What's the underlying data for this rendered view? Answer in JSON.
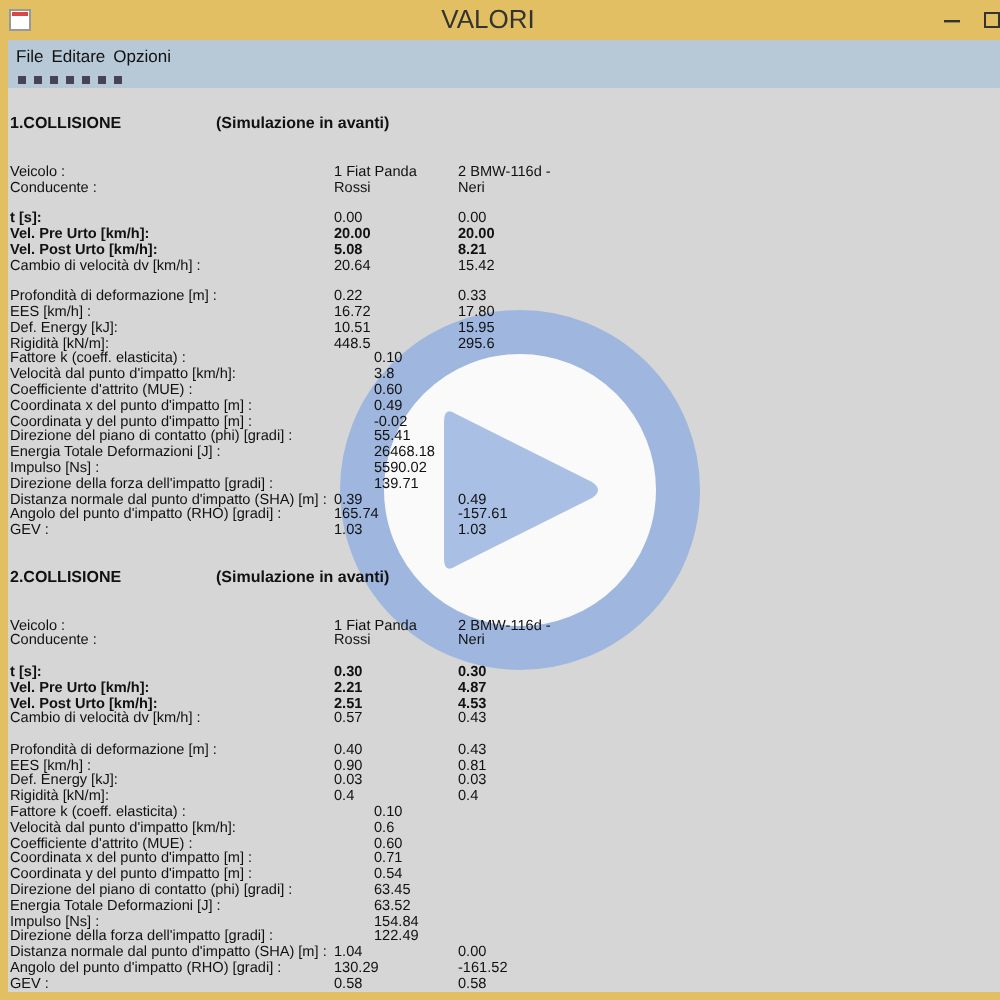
{
  "window": {
    "title": "VALORI"
  },
  "menu": [
    "File",
    "Editare",
    "Opzioni"
  ],
  "sections": [
    {
      "title": "1.COLLISIONE",
      "subtitle": "(Simulazione in avanti)",
      "rows": [
        {
          "kind": "gap"
        },
        {
          "kind": "pair",
          "label": "Veicolo :",
          "values": [
            "1  Fiat Panda",
            "2  BMW-116d -"
          ],
          "bold_label": false,
          "bold_values": false
        },
        {
          "kind": "pair",
          "label": "Conducente :",
          "values": [
            "Rossi",
            "Neri"
          ],
          "bold_label": false,
          "bold_values": false
        },
        {
          "kind": "gap"
        },
        {
          "kind": "pair",
          "label": "t [s]:",
          "values": [
            "0.00",
            "0.00"
          ],
          "bold_label": true,
          "bold_values": false
        },
        {
          "kind": "pair",
          "label": "Vel. Pre Urto [km/h]:",
          "values": [
            "20.00",
            "20.00"
          ],
          "bold_label": true,
          "bold_values": true
        },
        {
          "kind": "pair",
          "label": "Vel. Post Urto [km/h]:",
          "values": [
            "5.08",
            "8.21"
          ],
          "bold_label": true,
          "bold_values": true
        },
        {
          "kind": "pair",
          "label": "Cambio di velocità dv [km/h] :",
          "values": [
            "20.64",
            "15.42"
          ],
          "bold_label": false,
          "bold_values": false
        },
        {
          "kind": "gap"
        },
        {
          "kind": "pair",
          "label": "Profondità di deformazione [m] :",
          "values": [
            "0.22",
            "0.33"
          ],
          "bold_label": false,
          "bold_values": false
        },
        {
          "kind": "pair",
          "label": "EES [km/h] :",
          "values": [
            "16.72",
            "17.80"
          ],
          "bold_label": false,
          "bold_values": false
        },
        {
          "kind": "pair",
          "label": "Def. Energy [kJ]:",
          "values": [
            "10.51",
            "15.95"
          ],
          "bold_label": false,
          "bold_values": false
        },
        {
          "kind": "pair",
          "label": "Rigidità [kN/m]:",
          "values": [
            "448.5",
            "295.6"
          ],
          "bold_label": false,
          "bold_values": false
        },
        {
          "kind": "single",
          "label": "Fattore k (coeff. elasticita) :",
          "value": "0.10"
        },
        {
          "kind": "single",
          "label": "Velocità dal punto d'impatto [km/h]:",
          "value": "3.8"
        },
        {
          "kind": "single",
          "label": "Coefficiente d'attrito (MUE) :",
          "value": "0.60"
        },
        {
          "kind": "single",
          "label": "Coordinata x del punto d'impatto [m] :",
          "value": "0.49"
        },
        {
          "kind": "single",
          "label": "Coordinata y del punto d'impatto [m] :",
          "value": "-0.02"
        },
        {
          "kind": "single",
          "label": "Direzione del piano di contatto (phi) [gradi] :",
          "value": "55.41"
        },
        {
          "kind": "single",
          "label": "Energia Totale Deformazioni [J] :",
          "value": "26468.18"
        },
        {
          "kind": "single",
          "label": "Impulso [Ns] :",
          "value": "5590.02"
        },
        {
          "kind": "single",
          "label": "Direzione della forza dell'impatto [gradi] :",
          "value": "139.71"
        },
        {
          "kind": "pair",
          "label": "Distanza normale dal punto d'impatto (SHA) [m] :",
          "values": [
            "0.39",
            "0.49"
          ],
          "bold_label": false,
          "bold_values": false
        },
        {
          "kind": "pair",
          "label": "Angolo del punto d'impatto (RHO) [gradi] :",
          "values": [
            "165.74",
            "-157.61"
          ],
          "bold_label": false,
          "bold_values": false
        },
        {
          "kind": "pair",
          "label": "GEV :",
          "values": [
            "1.03",
            "1.03"
          ],
          "bold_label": false,
          "bold_values": false
        },
        {
          "kind": "gap"
        }
      ]
    },
    {
      "title": "2.COLLISIONE",
      "subtitle": "(Simulazione in avanti)",
      "rows": [
        {
          "kind": "gap"
        },
        {
          "kind": "pair",
          "label": "Veicolo :",
          "values": [
            "1  Fiat Panda",
            "2  BMW-116d -"
          ],
          "bold_label": false,
          "bold_values": false
        },
        {
          "kind": "pair",
          "label": "Conducente :",
          "values": [
            "Rossi",
            "Neri"
          ],
          "bold_label": false,
          "bold_values": false
        },
        {
          "kind": "gap"
        },
        {
          "kind": "pair",
          "label": "t [s]:",
          "values": [
            "0.30",
            "0.30"
          ],
          "bold_label": true,
          "bold_values": true
        },
        {
          "kind": "pair",
          "label": "Vel. Pre Urto [km/h]:",
          "values": [
            "2.21",
            "4.87"
          ],
          "bold_label": true,
          "bold_values": true
        },
        {
          "kind": "pair",
          "label": "Vel. Post Urto [km/h]:",
          "values": [
            "2.51",
            "4.53"
          ],
          "bold_label": true,
          "bold_values": true
        },
        {
          "kind": "pair",
          "label": "Cambio di velocità dv [km/h] :",
          "values": [
            "0.57",
            "0.43"
          ],
          "bold_label": false,
          "bold_values": false
        },
        {
          "kind": "gap"
        },
        {
          "kind": "pair",
          "label": "Profondità di deformazione [m] :",
          "values": [
            "0.40",
            "0.43"
          ],
          "bold_label": false,
          "bold_values": false
        },
        {
          "kind": "pair",
          "label": "EES [km/h] :",
          "values": [
            "0.90",
            "0.81"
          ],
          "bold_label": false,
          "bold_values": false
        },
        {
          "kind": "pair",
          "label": "Def. Energy [kJ]:",
          "values": [
            "0.03",
            "0.03"
          ],
          "bold_label": false,
          "bold_values": false
        },
        {
          "kind": "pair",
          "label": "Rigidità [kN/m]:",
          "values": [
            "0.4",
            "0.4"
          ],
          "bold_label": false,
          "bold_values": false
        },
        {
          "kind": "single",
          "label": "Fattore k (coeff. elasticita) :",
          "value": "0.10"
        },
        {
          "kind": "single",
          "label": "Velocità dal punto d'impatto [km/h]:",
          "value": "0.6"
        },
        {
          "kind": "single",
          "label": "Coefficiente d'attrito (MUE) :",
          "value": "0.60"
        },
        {
          "kind": "single",
          "label": "Coordinata x del punto d'impatto [m] :",
          "value": "0.71"
        },
        {
          "kind": "single",
          "label": "Coordinata y del punto d'impatto [m] :",
          "value": "0.54"
        },
        {
          "kind": "single",
          "label": "Direzione del piano di contatto (phi) [gradi] :",
          "value": "63.45"
        },
        {
          "kind": "single",
          "label": "Energia Totale Deformazioni [J] :",
          "value": "63.52"
        },
        {
          "kind": "single",
          "label": "Impulso [Ns] :",
          "value": "154.84"
        },
        {
          "kind": "single",
          "label": "Direzione della forza dell'impatto [gradi] :",
          "value": "122.49"
        },
        {
          "kind": "pair",
          "label": "Distanza normale dal punto d'impatto (SHA) [m] :",
          "values": [
            "1.04",
            "0.00"
          ],
          "bold_label": false,
          "bold_values": false
        },
        {
          "kind": "pair",
          "label": "Angolo del punto d'impatto (RHO) [gradi] :",
          "values": [
            "130.29",
            "-161.52"
          ],
          "bold_label": false,
          "bold_values": false
        },
        {
          "kind": "pair",
          "label": "GEV :",
          "values": [
            "0.58",
            "0.58"
          ],
          "bold_label": false,
          "bold_values": false
        }
      ]
    }
  ]
}
